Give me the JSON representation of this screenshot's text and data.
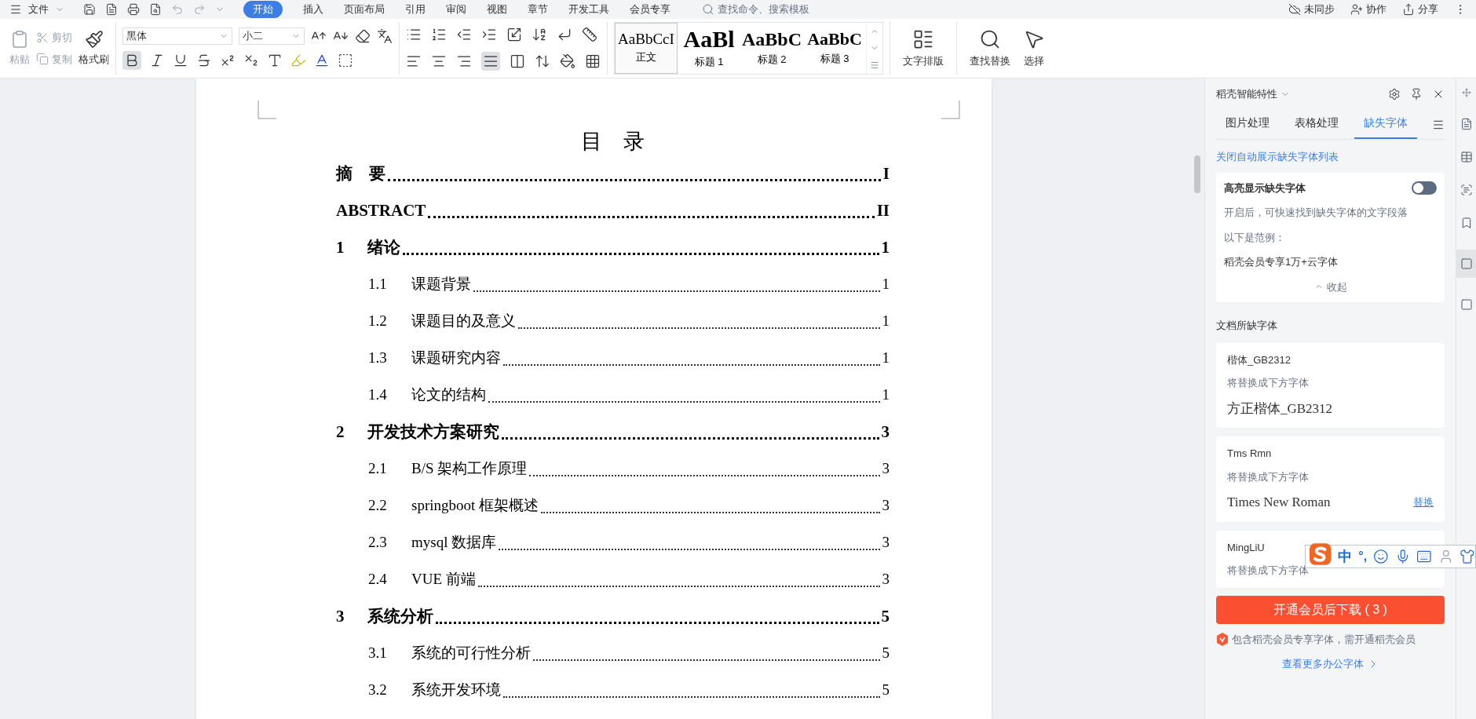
{
  "menu_bar": {
    "file_menu": "文件",
    "tabs": [
      {
        "label": "开始",
        "selected": true
      },
      {
        "label": "插入",
        "selected": false
      },
      {
        "label": "页面布局",
        "selected": false
      },
      {
        "label": "引用",
        "selected": false
      },
      {
        "label": "审阅",
        "selected": false
      },
      {
        "label": "视图",
        "selected": false
      },
      {
        "label": "章节",
        "selected": false
      },
      {
        "label": "开发工具",
        "selected": false
      },
      {
        "label": "会员专享",
        "selected": false
      }
    ],
    "search": {
      "placeholder": "查找命令、搜索模板"
    },
    "actions": [
      {
        "kind": "sync",
        "label": "未同步"
      },
      {
        "kind": "collab",
        "label": "协作"
      },
      {
        "kind": "share",
        "label": "分享"
      }
    ]
  },
  "toolbar": {
    "paste": "粘贴",
    "cut": "剪切",
    "copy": "复制",
    "format_painter": "格式刷",
    "font_family": "黑体",
    "font_size": "小二",
    "bold": true,
    "justify": true,
    "styles": [
      {
        "sample": "AaBbCcI",
        "label": "正文",
        "kind": "body",
        "selected": true
      },
      {
        "sample": "AaBl",
        "label": "标题 1",
        "kind": "h1",
        "selected": false
      },
      {
        "sample": "AaBbC",
        "label": "标题 2",
        "kind": "h2",
        "selected": false
      },
      {
        "sample": "AaBbC",
        "label": "标题 3",
        "kind": "h3",
        "selected": false
      }
    ],
    "text_layout": "文字排版",
    "find_replace": "查找替换",
    "select": "选择"
  },
  "document": {
    "title": "目　录",
    "entries": [
      {
        "title": "摘　要",
        "page": "I"
      },
      {
        "title": "ABSTRACT",
        "page": "II"
      },
      {
        "number": "1",
        "title": "绪论",
        "page": "1",
        "children": [
          {
            "number": "1.1",
            "title": "课题背景",
            "page": "1"
          },
          {
            "number": "1.2",
            "title": "课题目的及意义",
            "page": "1"
          },
          {
            "number": "1.3",
            "title": "课题研究内容",
            "page": "1"
          },
          {
            "number": "1.4",
            "title": "论文的结构",
            "page": "1"
          }
        ]
      },
      {
        "number": "2",
        "title": "开发技术方案研究",
        "page": "3",
        "children": [
          {
            "number": "2.1",
            "title": "B/S 架构工作原理",
            "page": "3"
          },
          {
            "number": "2.2",
            "title": "springboot 框架概述",
            "page": "3"
          },
          {
            "number": "2.3",
            "title": "mysql 数据库",
            "page": "3"
          },
          {
            "number": "2.4",
            "title": "VUE 前端",
            "page": "3"
          }
        ]
      },
      {
        "number": "3",
        "title": "系统分析",
        "page": "5",
        "children": [
          {
            "number": "3.1",
            "title": "系统的可行性分析",
            "page": "5"
          },
          {
            "number": "3.2",
            "title": "系统开发环境",
            "page": "5"
          }
        ]
      }
    ]
  },
  "side_panel": {
    "title": "稻壳智能特性",
    "tabs": [
      {
        "label": "图片处理",
        "selected": false
      },
      {
        "label": "表格处理",
        "selected": false
      },
      {
        "label": "缺失字体",
        "selected": true
      }
    ],
    "auto_show_link": "关闭自动展示缺失字体列表",
    "highlight_card": {
      "title": "高亮显示缺失字体",
      "on": false,
      "description": "开启后，可快速找到缺失字体的文字段落",
      "example_label": "以下是范例：",
      "example": "稻壳会员专享1万+云字体",
      "collapse": "收起"
    },
    "missing_heading": "文档所缺字体",
    "fonts": [
      {
        "name": "楷体_GB2312",
        "hint": "将替换成下方字体",
        "replacement": "方正楷体_GB2312"
      },
      {
        "name": "Tms Rmn",
        "hint": "将替换成下方字体",
        "replacement": "Times New Roman",
        "action": "替换"
      },
      {
        "name": "MingLiU",
        "hint": "将替换成下方字体"
      }
    ],
    "download_button": "开通会员后下载 ( 3 )",
    "notice": "包含稻壳会员专享字体，需开通稻壳会员",
    "more_link": "查看更多办公字体"
  },
  "ime_bar": {
    "language": "中",
    "punctuation": "°,"
  }
}
